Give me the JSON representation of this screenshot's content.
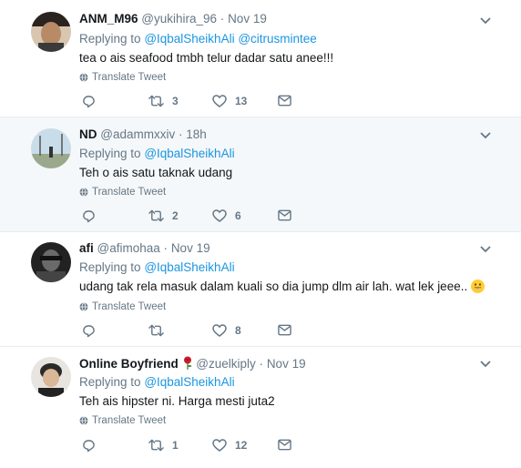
{
  "tweets": [
    {
      "name": "ANM_M96",
      "handle": "@yukihira_96",
      "time": "Nov 19",
      "reply_prefix": "Replying to",
      "reply_to": "@IqbalSheikhAli @citrusmintee",
      "text": "tea o ais seafood tmbh telur dadar satu anee!!!",
      "translate": "Translate Tweet",
      "retweets": "3",
      "likes": "13"
    },
    {
      "name": "ND",
      "handle": "@adammxxiv",
      "time": "18h",
      "reply_prefix": "Replying to",
      "reply_to": "@IqbalSheikhAli",
      "text": "Teh o ais satu taknak udang",
      "translate": "Translate Tweet",
      "retweets": "2",
      "likes": "6"
    },
    {
      "name": "afi",
      "handle": "@afimohaa",
      "time": "Nov 19",
      "reply_prefix": "Replying to",
      "reply_to": "@IqbalSheikhAli",
      "text": "udang tak rela masuk dalam kuali so dia jump dlm air lah. wat lek jeee..",
      "translate": "Translate Tweet",
      "retweets": "",
      "likes": "8"
    },
    {
      "name": "Online Boyfriend",
      "handle": "@zuelkiply",
      "time": "Nov 19",
      "reply_prefix": "Replying to",
      "reply_to": "@IqbalSheikhAli",
      "text": "Teh ais hipster ni. Harga mesti juta2",
      "translate": "Translate Tweet",
      "retweets": "1",
      "likes": "12"
    }
  ],
  "colors": {
    "link": "#1b95e0",
    "muted": "#657786",
    "highlight_bg": "#f5f8fa"
  },
  "icons": [
    "reply-icon",
    "retweet-icon",
    "like-icon",
    "dm-icon",
    "globe-icon",
    "chevron-down-icon",
    "rose-emoji-icon",
    "grinning-emoji-icon"
  ]
}
